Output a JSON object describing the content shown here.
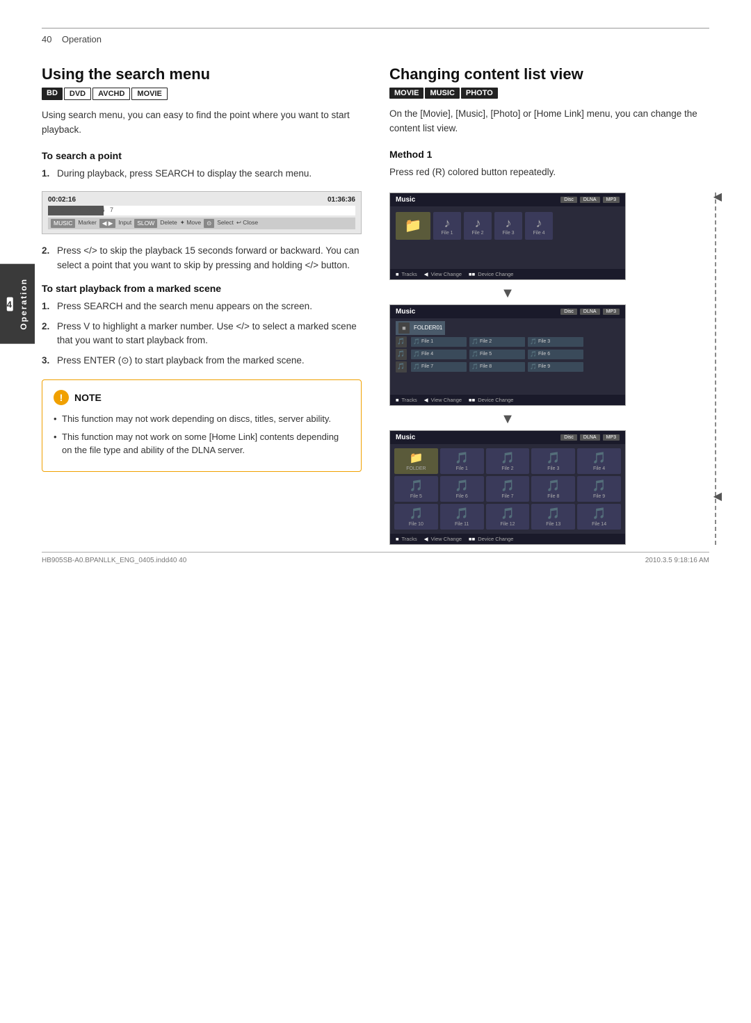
{
  "page": {
    "number": "40",
    "section": "Operation",
    "footer_left": "HB905SB-A0.BPANLLK_ENG_0405.indd40  40",
    "footer_right": "2010.3.5  9:18:16 AM"
  },
  "left_section": {
    "title": "Using the search menu",
    "badges": [
      "BD",
      "DVD",
      "AVCHD",
      "MOVIE"
    ],
    "intro": "Using search menu, you can easy to find the point where you want to start playback.",
    "sub1": {
      "heading": "To search a point",
      "steps": [
        "During playback, press SEARCH to display the search menu.",
        "Press </> to skip the playback 15 seconds forward or backward. You can select a point that you want to skip by pressing and holding </> button."
      ]
    },
    "sub2": {
      "heading": "To start playback from a marked scene",
      "steps": [
        "Press SEARCH and the search menu appears on the screen.",
        "Press V to highlight a marker number. Use </> to select a marked scene that you want to start playback from.",
        "Press ENTER (⊙) to start playback from the marked scene."
      ]
    },
    "note": {
      "title": "NOTE",
      "bullets": [
        "This function may not work depending on discs, titles, server ability.",
        "This function may not work on some [Home Link] contents depending on the file type and ability of the DLNA server."
      ]
    },
    "search_mockup": {
      "time_left": "00:02:16",
      "time_right": "01:36:36",
      "markers": "1  2  3  4 5  6  7",
      "controls": [
        "MUSIC",
        "Marker",
        "Input",
        "SLOW",
        "Delete",
        "Move",
        "Select",
        "Close"
      ]
    }
  },
  "right_section": {
    "title": "Changing content list view",
    "badges": [
      "MOVIE",
      "MUSIC",
      "PHOTO"
    ],
    "intro": "On the [Movie], [Music], [Photo] or [Home Link] menu, you can change the content list view.",
    "method1": {
      "heading": "Method 1",
      "text": "Press red (R) colored button repeatedly."
    },
    "screenshots": [
      {
        "id": "ss1",
        "title": "Music",
        "subtitle": "MP3",
        "footer_items": [
          "Tracks",
          "View Change",
          "Device Change"
        ],
        "view_type": "grid"
      },
      {
        "id": "ss2",
        "title": "Music",
        "subtitle": "MP3",
        "footer_items": [
          "Tracks",
          "View Change",
          "Device Change"
        ],
        "view_type": "list"
      },
      {
        "id": "ss3",
        "title": "Music",
        "subtitle": "MP3",
        "footer_items": [
          "Tracks",
          "View Change",
          "Device Change"
        ],
        "view_type": "large-grid"
      }
    ]
  },
  "sidebar": {
    "number": "4",
    "label": "Operation"
  }
}
